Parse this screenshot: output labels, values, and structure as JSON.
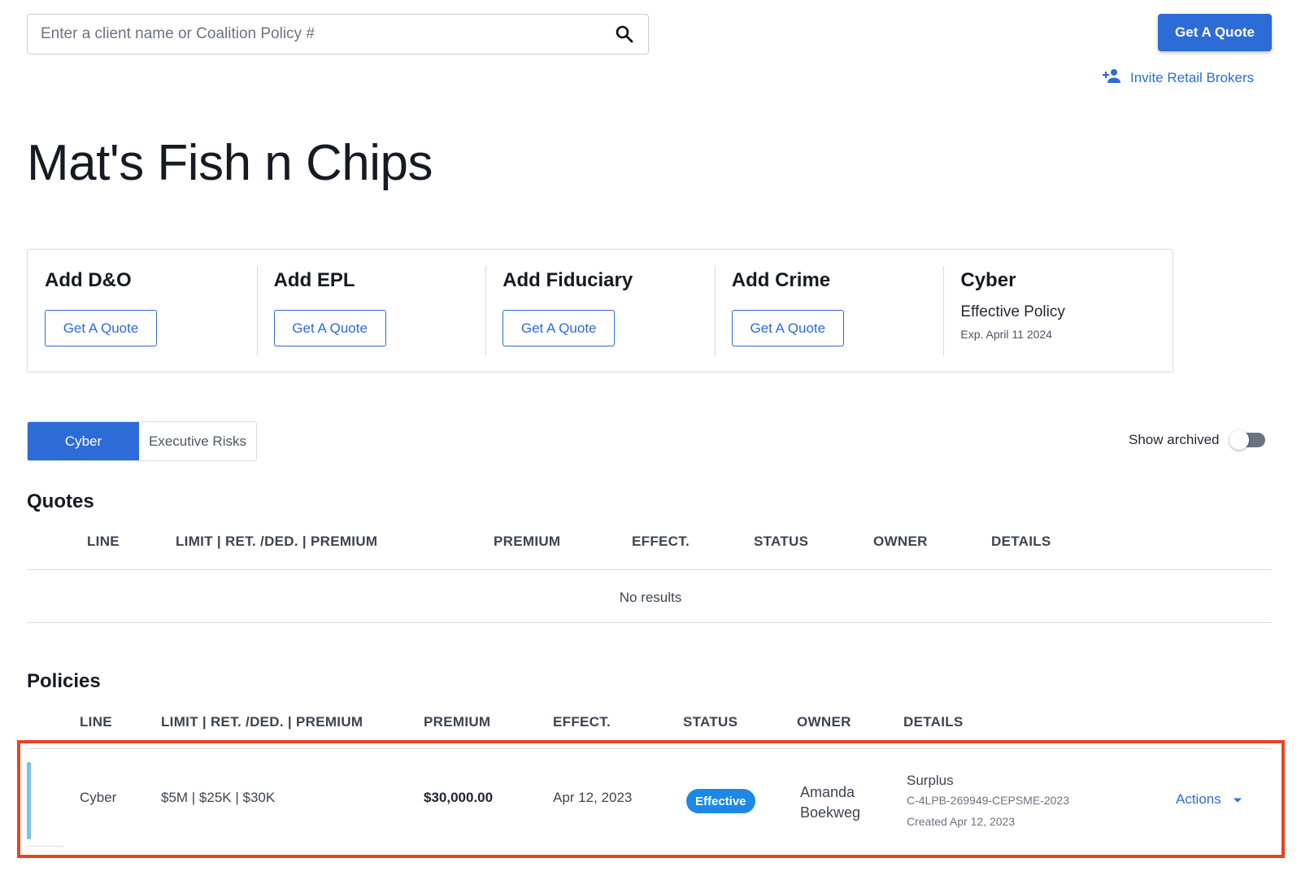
{
  "search": {
    "placeholder": "Enter a client name or Coalition Policy #",
    "value": ""
  },
  "header": {
    "get_quote_label": "Get A Quote",
    "invite_label": "Invite Retail Brokers"
  },
  "client": {
    "name": "Mat's Fish n Chips"
  },
  "products": [
    {
      "title": "Add D&O",
      "button": "Get A Quote"
    },
    {
      "title": "Add EPL",
      "button": "Get A Quote"
    },
    {
      "title": "Add Fiduciary",
      "button": "Get A Quote"
    },
    {
      "title": "Add Crime",
      "button": "Get A Quote"
    },
    {
      "title": "Cyber",
      "status": "Effective Policy",
      "expiry": "Exp. April 11 2024"
    }
  ],
  "tabs": [
    {
      "label": "Cyber",
      "active": true
    },
    {
      "label": "Executive Risks",
      "active": false
    }
  ],
  "archived": {
    "label": "Show archived",
    "enabled": false
  },
  "quotes": {
    "title": "Quotes",
    "columns": [
      "LINE",
      "LIMIT | RET. /DED. | PREMIUM",
      "PREMIUM",
      "EFFECT.",
      "STATUS",
      "OWNER",
      "DETAILS"
    ],
    "empty_text": "No results"
  },
  "policies": {
    "title": "Policies",
    "columns": [
      "LINE",
      "LIMIT | RET. /DED. | PREMIUM",
      "PREMIUM",
      "EFFECT.",
      "STATUS",
      "OWNER",
      "DETAILS"
    ],
    "rows": [
      {
        "line": "Cyber",
        "limits": "$5M | $25K | $30K",
        "premium": "$30,000.00",
        "effective": "Apr 12, 2023",
        "status": "Effective",
        "owner_first": "Amanda",
        "owner_last": "Boekweg",
        "details_type": "Surplus",
        "details_policy": "C-4LPB-269949-CEPSME-2023",
        "details_created": "Created Apr 12, 2023",
        "actions_label": "Actions"
      }
    ]
  },
  "colors": {
    "primary": "#2d6bd6",
    "badge": "#1e88e5",
    "highlight": "#e8431f",
    "row_accent": "#7dc3e8"
  }
}
